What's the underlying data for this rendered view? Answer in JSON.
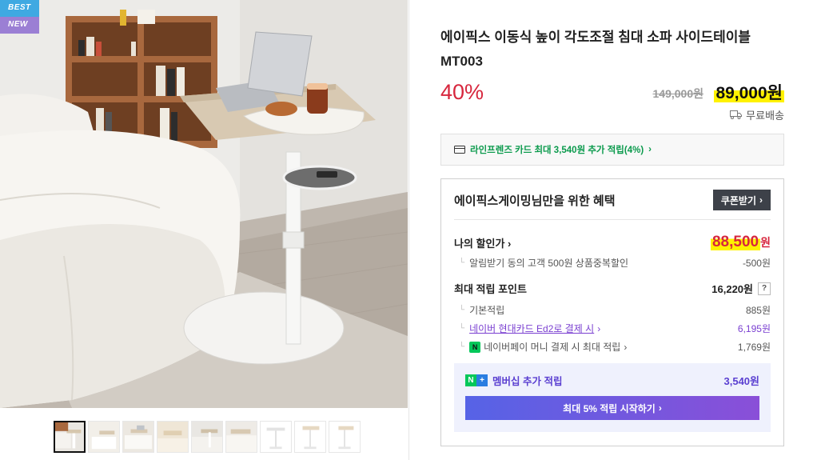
{
  "badges": {
    "best": "BEST",
    "new": "NEW"
  },
  "thumbnails_count": 9,
  "product": {
    "title": "에이픽스 이동식 높이 각도조절 침대 소파 사이드테이블 MT003",
    "discount": "40%",
    "original_price": "149,000원",
    "price": "89,000원",
    "shipping": "무료배송"
  },
  "card_promo": {
    "text": "라인프렌즈 카드 최대 3,540원 추가 적립(4%)"
  },
  "benefit": {
    "title": "에이픽스게이밍님만을 위한 혜택",
    "coupon_button": "쿠폰받기",
    "my_price_label": "나의 할인가",
    "my_price_value": "88,500",
    "my_price_unit": "원",
    "alarm_discount_label": "알림받기 동의 고객 500원 상품중복할인",
    "alarm_discount_value": "-500원",
    "points_label": "최대 적립 포인트",
    "points_value": "16,220원",
    "points_help": "?",
    "base_points_label": "기본적립",
    "base_points_value": "885원",
    "hyundai_label": "네이버 현대카드 Ed2로 결제 시",
    "hyundai_value": "6,195원",
    "npay_badge": "N",
    "npay_label": "네이버페이 머니 결제 시 최대 적립",
    "npay_value": "1,769원",
    "member_label": "멤버십 추가 적립",
    "member_value": "3,540원",
    "start_button": "최대 5% 적립 시작하기"
  },
  "colors": {
    "discount_red": "#d7263d",
    "highlight_yellow": "#fff200",
    "naver_green": "#03c75a",
    "membership_purple": "#5a3fd1"
  }
}
